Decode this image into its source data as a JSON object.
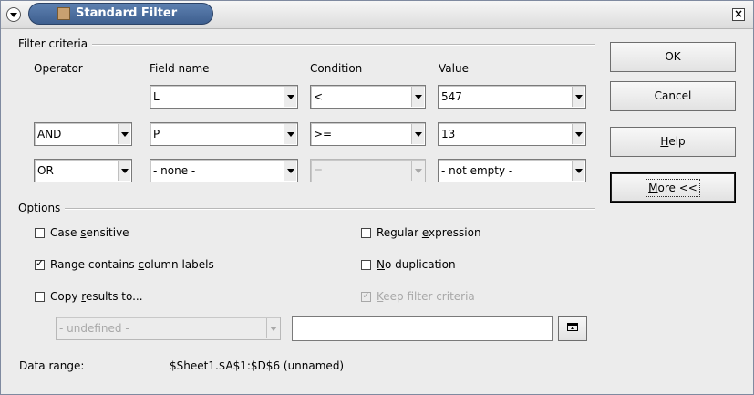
{
  "window": {
    "title": "Standard Filter"
  },
  "filter_criteria": {
    "heading": "Filter criteria",
    "columns": {
      "operator": "Operator",
      "field_name": "Field name",
      "condition": "Condition",
      "value": "Value"
    },
    "rows": [
      {
        "operator": "",
        "field_name": "L",
        "condition": "<",
        "value": "547"
      },
      {
        "operator": "AND",
        "field_name": "P",
        "condition": ">=",
        "value": "13"
      },
      {
        "operator": "OR",
        "field_name": "- none -",
        "condition": "=",
        "value": "- not empty -"
      }
    ]
  },
  "options": {
    "heading": "Options",
    "case_sensitive": {
      "pre": "Case ",
      "u": "s",
      "post": "ensitive",
      "checked": false
    },
    "range_contains_labels": {
      "pre": "Range contains ",
      "u": "c",
      "post": "olumn labels",
      "checked": true
    },
    "copy_results": {
      "pre": "Copy ",
      "u": "r",
      "post": "esults to...",
      "checked": false
    },
    "regular_expression": {
      "pre": "Regular ",
      "u": "e",
      "post": "xpression",
      "checked": false
    },
    "no_duplication": {
      "pre": "",
      "u": "N",
      "post": "o duplication",
      "checked": false
    },
    "keep_filter": {
      "pre": "",
      "u": "K",
      "post": "eep filter criteria",
      "checked": true,
      "disabled": true
    },
    "copy_target_select": "- undefined -",
    "copy_target_input": ""
  },
  "data_range": {
    "label": "Data range:",
    "value": "$Sheet1.$A$1:$D$6 (unnamed)"
  },
  "buttons": {
    "ok": "OK",
    "cancel": "Cancel",
    "help": {
      "u": "H",
      "post": "elp"
    },
    "more": {
      "u": "M",
      "post": "ore <<"
    }
  },
  "icons": {
    "window_menu": "chevron-down-icon",
    "app": "application-icon",
    "close": "close-icon",
    "shrink": "shrink-dialog-icon"
  }
}
